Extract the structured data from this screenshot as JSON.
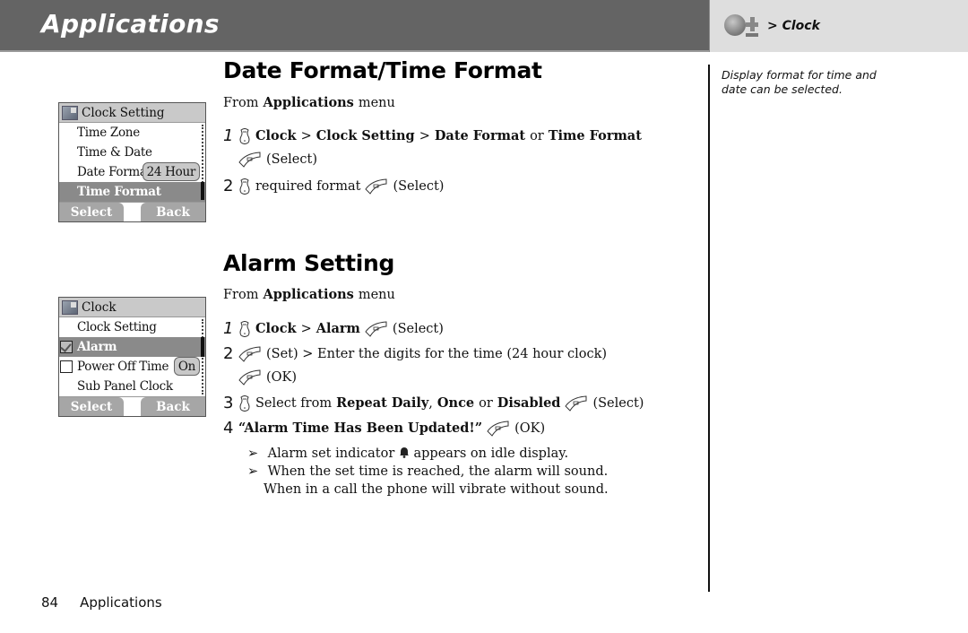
{
  "header": {
    "title": "Applications",
    "breadcrumb_icon": "applications-menu-icon",
    "breadcrumb": "> Clock"
  },
  "sidebar": {
    "note": "Display format for time and date can be selected."
  },
  "sections": {
    "date_time_format": {
      "heading": "Date Format/Time Format",
      "from_prefix": "From",
      "from_menu": "Applications",
      "from_suffix": "menu",
      "step1": {
        "num": "1",
        "clock": "Clock",
        "sep1": ">",
        "clock_setting": "Clock Setting",
        "sep2": ">",
        "date_format": "Date Format",
        "or": "or",
        "time_format": "Time Format",
        "select": "(Select)"
      },
      "step2": {
        "num": "2",
        "text": "required format",
        "select": "(Select)"
      }
    },
    "alarm_setting": {
      "heading": "Alarm Setting",
      "from_prefix": "From",
      "from_menu": "Applications",
      "from_suffix": "menu",
      "step1": {
        "num": "1",
        "clock": "Clock",
        "sep": ">",
        "alarm": "Alarm",
        "select": "(Select)"
      },
      "step2": {
        "num": "2",
        "text": "(Set) > Enter the digits for the time (24 hour clock)",
        "ok": "(OK)"
      },
      "step3": {
        "num": "3",
        "prefix": "Select from",
        "opt1": "Repeat Daily",
        "comma": ",",
        "opt2": "Once",
        "or": "or",
        "opt3": "Disabled",
        "select": "(Select)"
      },
      "step4": {
        "num": "4",
        "message": "“Alarm Time Has Been Updated!”",
        "ok": "(OK)"
      },
      "notes": {
        "arrow": "➢",
        "note1_a": "Alarm set indicator",
        "note1_b": "appears on idle display.",
        "note2_line1": "When the set time is reached, the alarm will sound.",
        "note2_line2": "When in a call the phone will vibrate without sound."
      }
    }
  },
  "screens": {
    "clock_setting": {
      "title": "Clock Setting",
      "items": [
        "Time Zone",
        "Time & Date",
        "Date Format",
        "Time Format"
      ],
      "selected_index": 3,
      "popup": "24 Hour",
      "softkey_left": "Select",
      "softkey_right": "Back"
    },
    "clock": {
      "title": "Clock",
      "items": [
        "Clock Setting",
        "Alarm",
        "Power Off Time",
        "Sub Panel Clock"
      ],
      "selected_index": 1,
      "alarm_checked": true,
      "power_off_checked": false,
      "popup": "On",
      "softkey_left": "Select",
      "softkey_right": "Back"
    }
  },
  "footer": {
    "page_number": "84",
    "section": "Applications"
  }
}
